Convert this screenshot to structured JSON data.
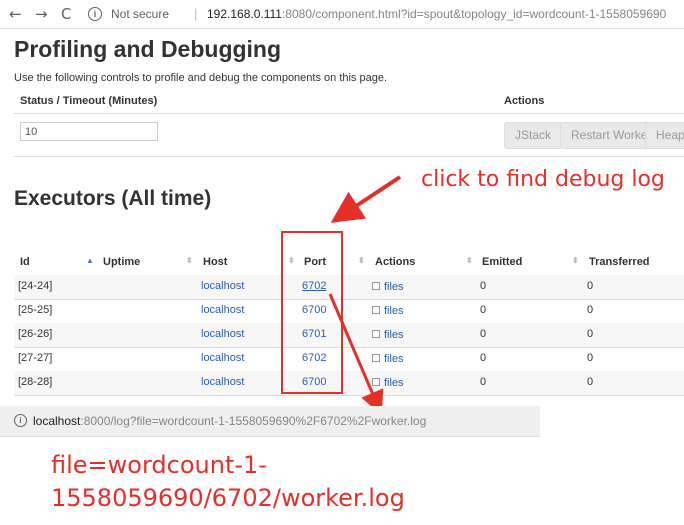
{
  "browser": {
    "back_icon": "←",
    "forward_icon": "→",
    "reload_icon": "C",
    "insecure_label": "Not secure",
    "separator": "|",
    "url_host": "192.168.0.111",
    "url_rest": ":8080/component.html?id=spout&topology_id=wordcount-1-1558059690"
  },
  "profiling": {
    "title": "Profiling and Debugging",
    "description": "Use the following controls to profile and debug the components on this page.",
    "col_status": "Status / Timeout (Minutes)",
    "col_actions": "Actions",
    "timeout_value": "10",
    "buttons": {
      "jstack": "JStack",
      "restart": "Restart Worker",
      "heap": "Heap"
    }
  },
  "annotation_top": "click to find debug log",
  "executors": {
    "title": "Executors (All time)",
    "columns": [
      "Id",
      "Uptime",
      "Host",
      "Port",
      "Actions",
      "Emitted",
      "Transferred"
    ],
    "rows": [
      {
        "id": "[24-24]",
        "host": "localhost",
        "port": "6702",
        "action": "files",
        "emitted": "0",
        "transferred": "0"
      },
      {
        "id": "[25-25]",
        "host": "localhost",
        "port": "6700",
        "action": "files",
        "emitted": "0",
        "transferred": "0"
      },
      {
        "id": "[26-26]",
        "host": "localhost",
        "port": "6701",
        "action": "files",
        "emitted": "0",
        "transferred": "0"
      },
      {
        "id": "[27-27]",
        "host": "localhost",
        "port": "6702",
        "action": "files",
        "emitted": "0",
        "transferred": "0"
      },
      {
        "id": "[28-28]",
        "host": "localhost",
        "port": "6700",
        "action": "files",
        "emitted": "0",
        "transferred": "0"
      }
    ]
  },
  "status_bar": {
    "url_host": "localhost",
    "url_rest": ":8000/log?file=wordcount-1-1558059690%2F6702%2Fworker.log"
  },
  "annotation_bottom": "file=wordcount-1-1558059690/6702/worker.log",
  "colors": {
    "annotation": "#e5302a",
    "link": "#2a5db0"
  }
}
